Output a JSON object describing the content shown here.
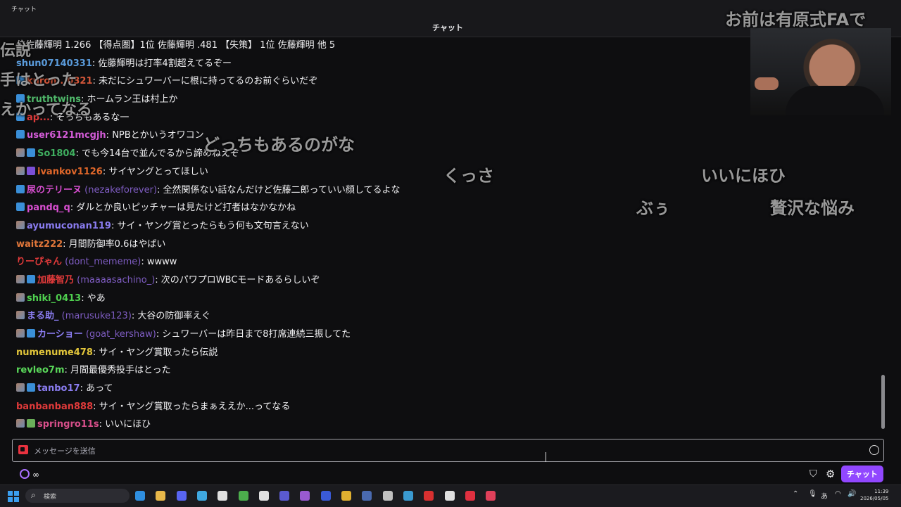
{
  "window": {
    "title": "チャット"
  },
  "header": {
    "title": "チャット"
  },
  "messages": [
    {
      "badges": [],
      "user": "",
      "user_color": "#efeff1",
      "login": "",
      "text": "位佐藤輝明 1.266 【得点圏】1位 佐藤輝明 .481 【失策】 1位 佐藤輝明 他 5"
    },
    {
      "badges": [],
      "user": "shun07140331",
      "user_color": "#5a9bdb",
      "login": "",
      "text": "佐藤輝明は打率4割超えてるぞー"
    },
    {
      "badges": [
        "sub"
      ],
      "user": "kuron...0321",
      "user_color": "#d4573a",
      "login": "",
      "text": "未だにシュワーバーに根に持ってるのお前ぐらいだぞ"
    },
    {
      "badges": [
        "sub"
      ],
      "user": "truthtwins",
      "user_color": "#4fb86a",
      "login": "",
      "text": "ホームラン王は村上か"
    },
    {
      "badges": [
        "sub"
      ],
      "user": "ap...",
      "user_color": "#e03a3a",
      "login": "",
      "text": "そっちもあるな一"
    },
    {
      "badges": [
        "sub"
      ],
      "user": "user6121mcgjh",
      "user_color": "#d25bd6",
      "login": "",
      "text": "NPBとかいうオワコン"
    },
    {
      "badges": [
        "img",
        "sub"
      ],
      "user": "So1804",
      "user_color": "#3fae5f",
      "login": "",
      "text": "でも今14台で並んでるから諦めねえぞ"
    },
    {
      "badges": [
        "img",
        "pur"
      ],
      "user": "ivankov1126",
      "user_color": "#e0672a",
      "login": "",
      "text": "サイヤングとってほしい"
    },
    {
      "badges": [
        "sub"
      ],
      "user": "尿のテリーヌ",
      "user_color": "#d84fd0",
      "login": "(nezakeforever)",
      "text": "全然関係ない話なんだけど佐藤二郎っていい顔してるよな"
    },
    {
      "badges": [
        "sub"
      ],
      "user": "pandq_q",
      "user_color": "#d84fd0",
      "login": "",
      "text": "ダルとか良いピッチャーは見たけど打者はなかなかね"
    },
    {
      "badges": [
        "img"
      ],
      "user": "ayumuconan119",
      "user_color": "#8a7cf0",
      "login": "",
      "text": "サイ・ヤング賞とったらもう何も文句言えない"
    },
    {
      "badges": [],
      "user": "waitz222",
      "user_color": "#e0763a",
      "login": "",
      "text": "月間防御率0.6はやばい"
    },
    {
      "badges": [],
      "user": "りーぴゃん",
      "user_color": "#e03a3a",
      "login": "(dont_mememe)",
      "text": "wwww"
    },
    {
      "badges": [
        "img",
        "sub"
      ],
      "user": "加藤智乃",
      "user_color": "#e03a3a",
      "login": "(maaaasachino_)",
      "text": "次のパワプロWBCモードあるらしいぞ"
    },
    {
      "badges": [
        "img"
      ],
      "user": "shiki_0413",
      "user_color": "#4fd04f",
      "login": "",
      "text": "やあ"
    },
    {
      "badges": [
        "img"
      ],
      "user": "まる助_",
      "user_color": "#8a7cf0",
      "login": "(marusuke123)",
      "text": "大谷の防御率えぐ"
    },
    {
      "badges": [
        "img",
        "sub"
      ],
      "user": "カーショー",
      "user_color": "#8a7cf0",
      "login": "(goat_kershaw)",
      "text": "シュワーバーは昨日まで8打席連続三振してた"
    },
    {
      "badges": [],
      "user": "numenume478",
      "user_color": "#e0c43a",
      "login": "",
      "text": "サイ・ヤング賞取ったら伝説"
    },
    {
      "badges": [],
      "user": "revleo7m",
      "user_color": "#5ad85a",
      "login": "",
      "text": "月間最優秀投手はとった"
    },
    {
      "badges": [
        "img",
        "sub"
      ],
      "user": "tanbo17",
      "user_color": "#8a7cf0",
      "login": "",
      "text": "あって"
    },
    {
      "badges": [],
      "user": "banbanban888",
      "user_color": "#e03a3a",
      "login": "",
      "text": "サイ・ヤング賞取ったらまぁええか...ってなる"
    },
    {
      "badges": [
        "img",
        "grn"
      ],
      "user": "springro11s",
      "user_color": "#d84f8a",
      "login": "",
      "text": "いいにほひ"
    }
  ],
  "overlays": [
    {
      "text": "お前は有原式FAで",
      "size": 24
    },
    {
      "text": "伝説",
      "size": 22
    },
    {
      "text": "手はとった",
      "size": 22
    },
    {
      "text": "えかってなる",
      "size": 22
    },
    {
      "text": "どっちもあるのがな",
      "size": 24
    },
    {
      "text": "くっさ",
      "size": 24
    },
    {
      "text": "いいにほひ",
      "size": 24
    },
    {
      "text": "ぶぅ",
      "size": 24
    },
    {
      "text": "贅沢な悩み",
      "size": 24
    }
  ],
  "input": {
    "placeholder": "メッセージを送信"
  },
  "bottom": {
    "points": "∞",
    "send_label": "チャット"
  },
  "taskbar": {
    "search_label": "検索",
    "ime": "あ",
    "time": "11:39",
    "date": "2026/05/05",
    "icons": [
      "edge-icon",
      "folder-icon",
      "discord-icon",
      "notepad-icon",
      "obs-icon",
      "minecraft-icon",
      "x-icon",
      "app-icon",
      "triangle-app-icon",
      "screen-icon",
      "chrome-icon",
      "steam-icon",
      "tool-icon",
      "globe-icon",
      "red-app-icon",
      "kick-icon",
      "red-square-icon",
      "pocket-icon"
    ]
  },
  "colors": {
    "accent": "#9147ff",
    "background": "#0e0e10"
  }
}
